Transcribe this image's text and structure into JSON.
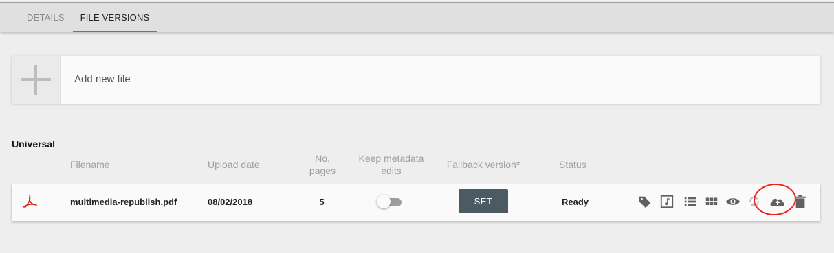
{
  "tabs": [
    {
      "label": "DETAILS",
      "active": false
    },
    {
      "label": "FILE VERSIONS",
      "active": true
    }
  ],
  "add_file": {
    "label": "Add new file"
  },
  "section": {
    "title": "Universal",
    "columns": {
      "filename": "Filename",
      "upload_date": "Upload date",
      "pages": "No. pages",
      "keep_metadata": "Keep metadata edits",
      "fallback": "Fallback version*",
      "status": "Status"
    },
    "rows": [
      {
        "icon": "pdf-icon",
        "filename": "multimedia-republish.pdf",
        "upload_date": "08/02/2018",
        "pages": "5",
        "keep_metadata": false,
        "fallback_button": "SET",
        "status": "Ready",
        "actions": [
          "tag-icon",
          "music-note-icon",
          "list-icon",
          "grid-icon",
          "eye-icon",
          "refresh-icon",
          "cloud-upload-icon",
          "trash-icon"
        ]
      }
    ]
  },
  "colors": {
    "accent_tab": "#3f7ae0",
    "set_button": "#4c5b63",
    "pdf_red": "#d8241c",
    "annotation": "#e8241c"
  }
}
